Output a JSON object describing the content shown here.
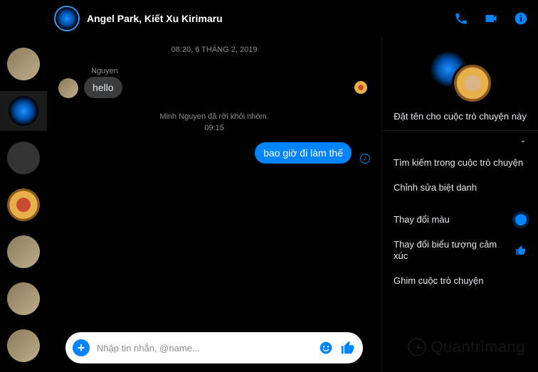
{
  "header": {
    "title": "Angel Park, Kiết Xu Kirimaru"
  },
  "sidebar": {
    "items": [
      {
        "name": "conv-0",
        "type": "group"
      },
      {
        "name": "conv-1",
        "type": "light",
        "active": true
      },
      {
        "name": "conv-2",
        "type": "cartoon"
      },
      {
        "name": "conv-3",
        "type": "gold"
      },
      {
        "name": "conv-4",
        "type": "group"
      },
      {
        "name": "conv-5",
        "type": "group"
      },
      {
        "name": "conv-6",
        "type": "group"
      }
    ]
  },
  "chat": {
    "date": "08:20, 6 THÁNG 2, 2019",
    "sender": "Nguyen",
    "msg_in": "hello",
    "system": "Minh Nguyen đã rời khỏi nhóm.",
    "time2": "09:15",
    "msg_out": "bao giờ đi làm thế"
  },
  "composer": {
    "placeholder": "Nhập tin nhắn, @name..."
  },
  "details": {
    "name_hint": "Đặt tên cho cuộc trò chuyện này",
    "options": [
      {
        "label": "Tìm kiếm trong cuộc trò chuyện",
        "icon": ""
      },
      {
        "label": "Chỉnh sửa biệt danh",
        "icon": ""
      },
      {
        "label": "Thay đổi màu",
        "icon": "color"
      },
      {
        "label": "Thay đổi biểu tượng cảm xúc",
        "icon": "thumb"
      },
      {
        "label": "Ghim cuộc trò chuyện",
        "icon": ""
      }
    ]
  },
  "watermark": "Quantrimang"
}
